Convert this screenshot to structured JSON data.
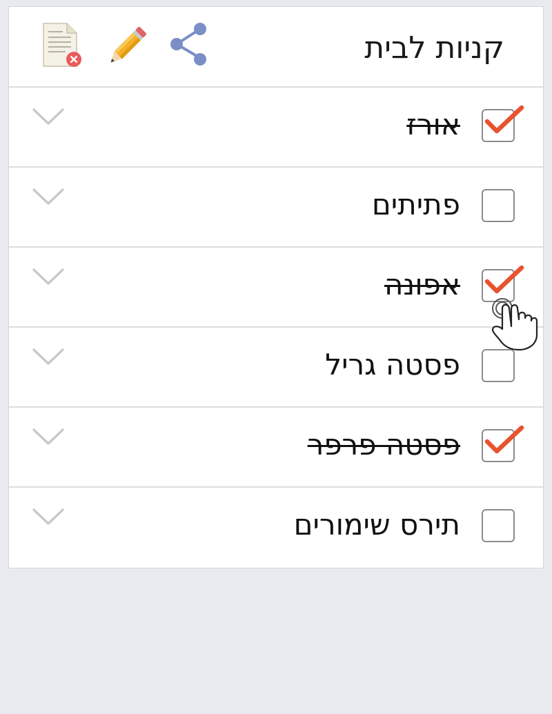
{
  "header": {
    "title": "קניות לבית",
    "icons": [
      "share-icon",
      "edit-pencil-icon",
      "delete-list-icon"
    ]
  },
  "items": [
    {
      "label": "אורז",
      "checked": true
    },
    {
      "label": "פתיתים",
      "checked": false
    },
    {
      "label": "אפונה",
      "checked": true
    },
    {
      "label": "פסטה גריל",
      "checked": false
    },
    {
      "label": "פסטה פרפר",
      "checked": true
    },
    {
      "label": "תירס שימורים",
      "checked": false
    }
  ],
  "colors": {
    "background": "#e9e9f0",
    "check_mark": "#e8532f",
    "share_icon": "#7b8ec6",
    "divider": "#dcdce2"
  }
}
